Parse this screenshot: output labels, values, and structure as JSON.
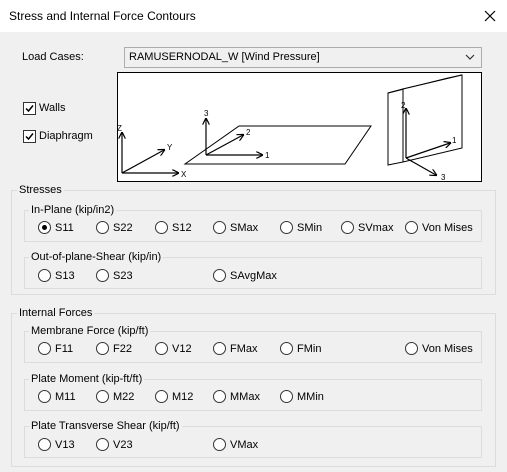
{
  "window": {
    "title": "Stress and Internal Force Contours"
  },
  "load_cases": {
    "label": "Load Cases:",
    "selected": "RAMUSERNODAL_W [Wind Pressure]"
  },
  "checkboxes": [
    {
      "label": "Walls",
      "checked": true
    },
    {
      "label": "Diaphragm",
      "checked": true
    }
  ],
  "diagram_labels": {
    "axis_z": "Z",
    "axis_y": "Y",
    "axis_x": "X",
    "plane_3": "3",
    "plane_2": "2",
    "plane_1": "1",
    "wall_2": "2",
    "wall_1": "1",
    "wall_3": "3"
  },
  "stresses": {
    "title": "Stresses",
    "in_plane": {
      "title": "In-Plane (kip/in2)",
      "options": [
        "S11",
        "S22",
        "S12",
        "SMax",
        "SMin",
        "SVmax",
        "Von Mises"
      ],
      "selected": "S11"
    },
    "out_of_plane": {
      "title": "Out-of-plane-Shear (kip/in)",
      "options": [
        "S13",
        "S23",
        "SAvgMax"
      ]
    }
  },
  "internal_forces": {
    "title": "Internal Forces",
    "membrane": {
      "title": "Membrane Force (kip/ft)",
      "options": [
        "F11",
        "F22",
        "V12",
        "FMax",
        "FMin",
        "Von Mises"
      ]
    },
    "plate_moment": {
      "title": "Plate Moment (kip-ft/ft)",
      "options": [
        "M11",
        "M22",
        "M12",
        "MMax",
        "MMin"
      ]
    },
    "plate_shear": {
      "title": "Plate Transverse Shear (kip/ft)",
      "options": [
        "V13",
        "V23",
        "VMax"
      ]
    }
  }
}
